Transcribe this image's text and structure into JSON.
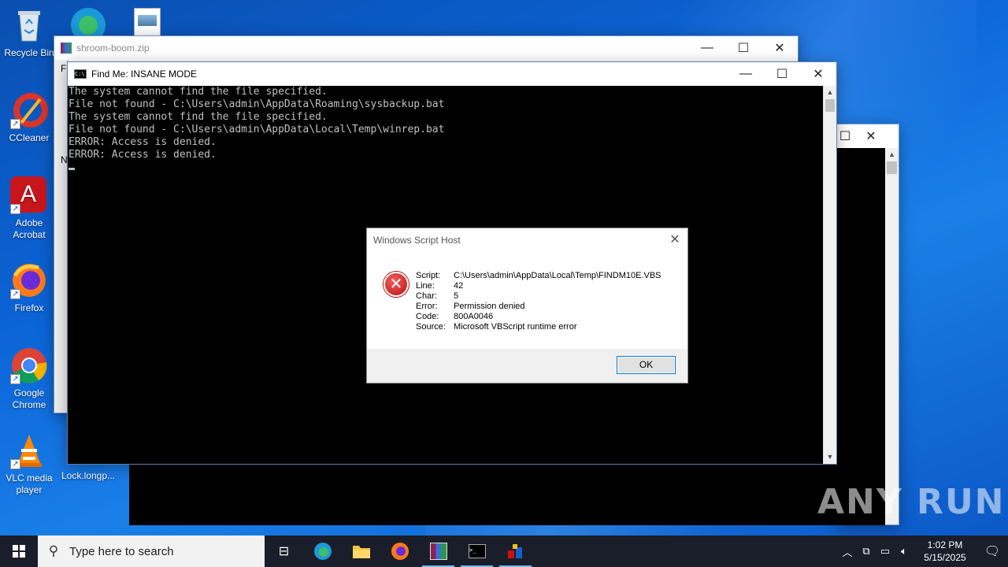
{
  "desktop": {
    "icons": [
      {
        "label": "Recycle Bin"
      },
      {
        "label": "CCleaner"
      },
      {
        "label": "Adobe Acrobat"
      },
      {
        "label": "Firefox"
      },
      {
        "label": "Google Chrome"
      },
      {
        "label": "VLC media player"
      },
      {
        "label": "Lock.longp..."
      }
    ]
  },
  "zip_window": {
    "title": "shroom-boom.zip",
    "side_text_1": "Fi",
    "side_text_2": "N"
  },
  "console": {
    "title": "Find Me: INSANE MODE",
    "lines": [
      "The system cannot find the file specified.",
      "File not found - C:\\Users\\admin\\AppData\\Roaming\\sysbackup.bat",
      "The system cannot find the file specified.",
      "File not found - C:\\Users\\admin\\AppData\\Local\\Temp\\winrep.bat",
      "ERROR: Access is denied.",
      "ERROR: Access is denied."
    ]
  },
  "dialog": {
    "title": "Windows Script Host",
    "fields": [
      {
        "label": "Script:",
        "value": "C:\\Users\\admin\\AppData\\Local\\Temp\\FINDM10E.VBS"
      },
      {
        "label": "Line:",
        "value": "42"
      },
      {
        "label": "Char:",
        "value": "5"
      },
      {
        "label": "Error:",
        "value": "Permission denied"
      },
      {
        "label": "Code:",
        "value": "800A0046"
      },
      {
        "label": "Source:",
        "value": "Microsoft VBScript runtime error"
      }
    ],
    "ok_label": "OK"
  },
  "taskbar": {
    "search_placeholder": "Type here to search",
    "time": "1:02 PM",
    "date": "5/15/2025"
  },
  "watermark": "ANY RUN"
}
